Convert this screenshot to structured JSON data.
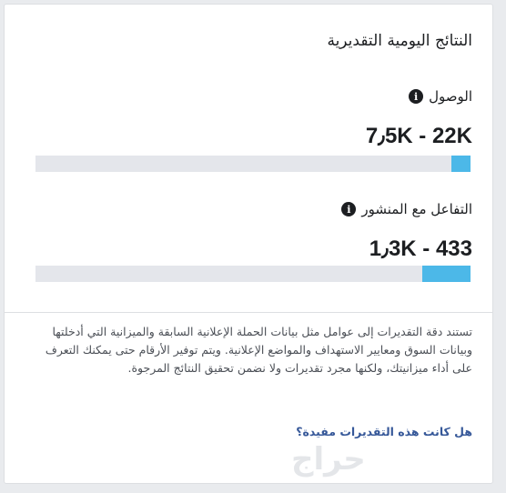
{
  "title": "النتائج اليومية التقديرية",
  "reach": {
    "label": "الوصول",
    "value": "7٫5K - 22K",
    "bar_fill_percent": 4.5
  },
  "engagement": {
    "label": "التفاعل مع المنشور",
    "value": "1٫3K - 433",
    "bar_fill_percent": 11
  },
  "description": "تستند دقة التقديرات إلى عوامل مثل بيانات الحملة الإعلانية السابقة والميزانية التي أدخلتها وبيانات السوق ومعايير الاستهداف والمواضع الإعلانية. ويتم توفير الأرقام حتى يمكنك التعرف على أداء ميزانيتك، ولكنها مجرد تقديرات ولا نضمن تحقيق النتائج المرجوة.",
  "feedback_link": "هل كانت هذه التقديرات مفيدة؟",
  "watermark": "حراج",
  "colors": {
    "bar_fill": "#4cb8e8",
    "bar_track": "#e4e6eb",
    "link": "#365899"
  },
  "icons": {
    "info": "info-icon"
  }
}
